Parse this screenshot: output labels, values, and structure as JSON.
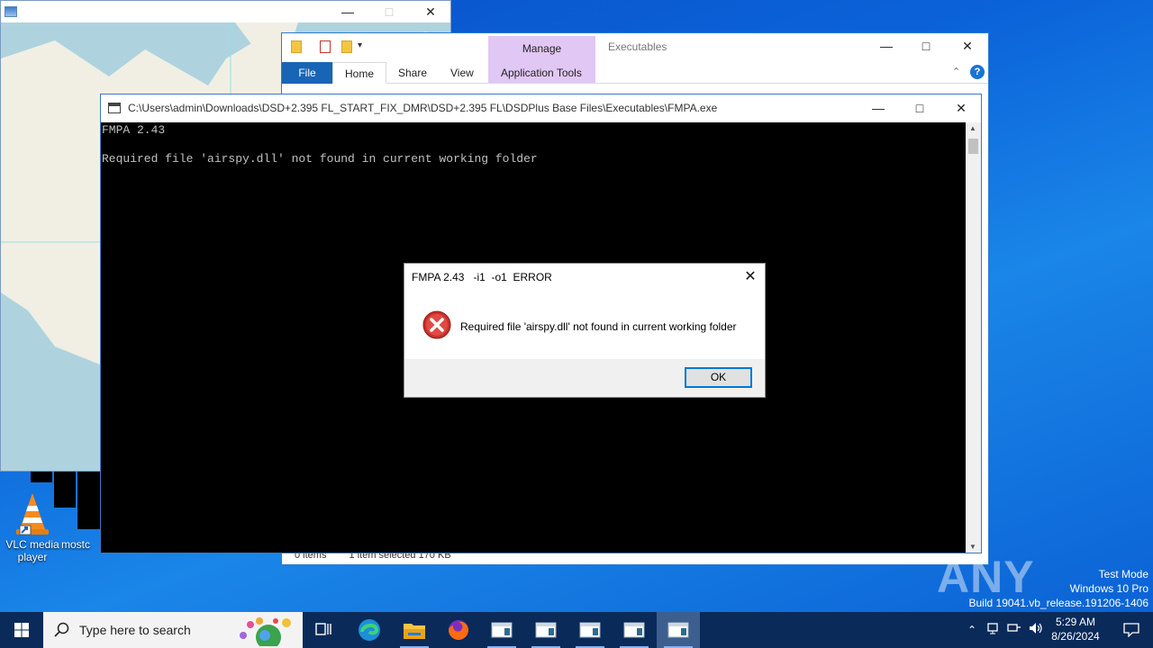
{
  "desktop": {
    "icons": [
      {
        "label_line1": "VLC media",
        "label_line2": "player"
      },
      {
        "label_line1": "mostc",
        "label_line2": ""
      }
    ]
  },
  "explorer": {
    "manage_tab": "Manage",
    "folder_name": "Executables",
    "tabs": [
      "File",
      "Home",
      "Share",
      "View",
      "Application Tools"
    ],
    "status_items": "0 items",
    "status_selected": "1 item selected  170 KB"
  },
  "console": {
    "title": "C:\\Users\\admin\\Downloads\\DSD+2.395 FL_START_FIX_DMR\\DSD+2.395 FL\\DSDPlus Base Files\\Executables\\FMPA.exe",
    "lines": [
      "FMPA 2.43",
      "",
      "Required file 'airspy.dll' not found in current working folder"
    ]
  },
  "dialog": {
    "title": "FMPA 2.43   -i1  -o1  ERROR",
    "message": "Required file 'airspy.dll' not found in current working folder",
    "ok_label": "OK"
  },
  "watermark": {
    "text": "ANY RUN"
  },
  "system_info": {
    "line1": "Test Mode",
    "line2": "Windows 10 Pro",
    "line3": "Build 19041.vb_release.191206-1406"
  },
  "taskbar": {
    "search_placeholder": "Type here to search",
    "time": "5:29 AM",
    "date": "8/26/2024"
  },
  "colors": {
    "explorer_accent": "#1965b5",
    "manage_tab": "#e1c7f4",
    "console_bg": "#000000",
    "taskbar_bg": "#0a2a59",
    "error_red": "#d63031"
  }
}
